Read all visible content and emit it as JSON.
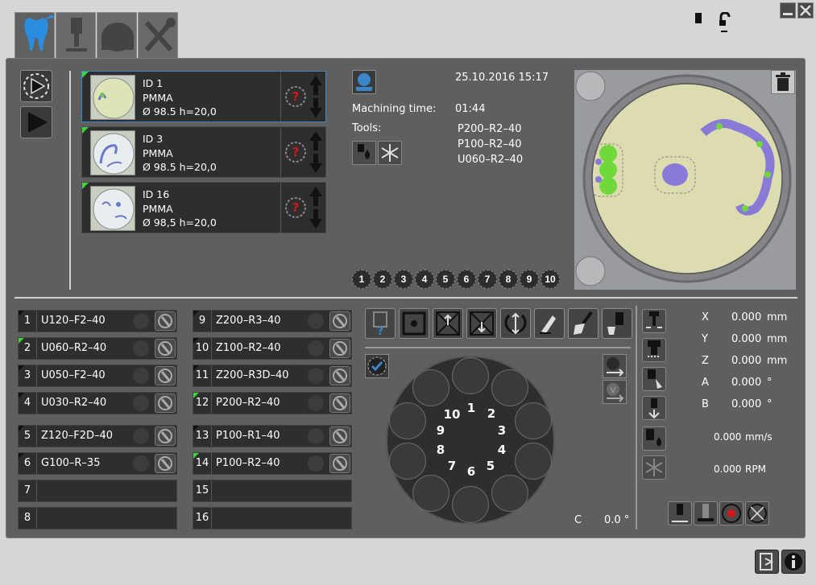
{
  "tabs": [
    {
      "name": "dental",
      "icon": "tooth-icon",
      "active": true
    },
    {
      "name": "machine",
      "icon": "spindle-icon"
    },
    {
      "name": "blank",
      "icon": "blank-icon"
    },
    {
      "name": "service",
      "icon": "tools-icon"
    }
  ],
  "window_controls": {
    "minimize": "minimize-icon",
    "close": "close-icon"
  },
  "jobs": [
    {
      "id_label": "ID  1",
      "material": "PMMA",
      "dims": "Ø 98.5   h=20,0",
      "selected": true,
      "status": "green"
    },
    {
      "id_label": "ID  3",
      "material": "PMMA",
      "dims": "Ø 98.5   h=20,0",
      "selected": false,
      "status": "green"
    },
    {
      "id_label": "ID  16",
      "material": "PMMA",
      "dims": "Ø 98,5   h=20,0",
      "selected": false,
      "status": "green"
    }
  ],
  "job_info": {
    "datetime": "25.10.2016 15:17",
    "machining_time_label": "Machining time:",
    "machining_time": "01:44",
    "tools_label": "Tools:",
    "tools": [
      "P200–R2–40",
      "P100–R2–40",
      "U060–R2–40"
    ]
  },
  "magazine_numbers": [
    "1",
    "2",
    "3",
    "4",
    "5",
    "6",
    "7",
    "8",
    "9",
    "10"
  ],
  "tool_slots_left": [
    {
      "num": "1",
      "name": "U120–F2–40",
      "flag": "black"
    },
    {
      "num": "2",
      "name": "U060–R2–40",
      "flag": "green"
    },
    {
      "num": "3",
      "name": "U050–F2–40",
      "flag": "black"
    },
    {
      "num": "4",
      "name": "U030–R2–40",
      "flag": "black"
    },
    {
      "num": "5",
      "name": "Z120–F2D–40",
      "flag": "black"
    },
    {
      "num": "6",
      "name": "G100–R–35",
      "flag": "black"
    },
    {
      "num": "7",
      "name": "",
      "flag": ""
    },
    {
      "num": "8",
      "name": "",
      "flag": ""
    }
  ],
  "tool_slots_right": [
    {
      "num": "9",
      "name": "Z200–R3–40",
      "flag": "black"
    },
    {
      "num": "10",
      "name": "Z100–R2–40",
      "flag": "black"
    },
    {
      "num": "11",
      "name": "Z200–R3D–40",
      "flag": "black"
    },
    {
      "num": "12",
      "name": "P200–R2–40",
      "flag": "green"
    },
    {
      "num": "13",
      "name": "P100–R1–40",
      "flag": "black"
    },
    {
      "num": "14",
      "name": "P100–R2–40",
      "flag": "green"
    },
    {
      "num": "15",
      "name": "",
      "flag": ""
    },
    {
      "num": "16",
      "name": "",
      "flag": ""
    }
  ],
  "axes": [
    {
      "label": "X",
      "value": "0.000",
      "unit": "mm"
    },
    {
      "label": "Y",
      "value": "0.000",
      "unit": "mm"
    },
    {
      "label": "Z",
      "value": "0.000",
      "unit": "mm"
    },
    {
      "label": "A",
      "value": "0.000",
      "unit": "°"
    },
    {
      "label": "B",
      "value": "0.000",
      "unit": "°"
    }
  ],
  "feed": {
    "value": "0.000",
    "unit": "mm/s"
  },
  "spindle": {
    "value": "0.000",
    "unit": "RPM"
  },
  "c_axis": {
    "label": "C",
    "value": "0.0 °"
  },
  "colors": {
    "accent": "#3a86c8",
    "panel": "#5f5f5f",
    "status_green": "#3cd43c",
    "danger": "#d01818"
  }
}
